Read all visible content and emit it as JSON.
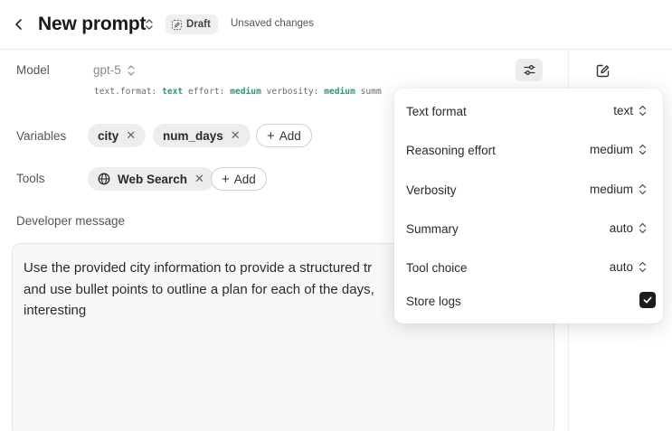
{
  "header": {
    "title": "New prompt",
    "draft_label": "Draft",
    "unsaved_label": "Unsaved changes"
  },
  "model": {
    "label": "Model",
    "value": "gpt-5",
    "params": [
      {
        "key": "text.format:",
        "value": "text"
      },
      {
        "key": "effort:",
        "value": "medium"
      },
      {
        "key": "verbosity:",
        "value": "medium"
      },
      {
        "key": "summ",
        "value": ""
      }
    ]
  },
  "variables": {
    "label": "Variables",
    "chips": [
      "city",
      "num_days"
    ],
    "add_label": "Add"
  },
  "tools": {
    "label": "Tools",
    "chips": [
      "Web Search"
    ],
    "add_label": "Add"
  },
  "developer": {
    "label": "Developer message",
    "text": "Use the provided city information to provide a structured tr\nand use bullet points to outline a plan for each of the days,\ninteresting"
  },
  "settings_popover": {
    "rows": [
      {
        "label": "Text format",
        "value": "text"
      },
      {
        "label": "Reasoning effort",
        "value": "medium"
      },
      {
        "label": "Verbosity",
        "value": "medium"
      },
      {
        "label": "Summary",
        "value": "auto"
      },
      {
        "label": "Tool choice",
        "value": "auto"
      }
    ],
    "store_logs_label": "Store logs",
    "store_logs_checked": true
  },
  "colors": {
    "param_value": "#2e9a6e",
    "checkbox": "#1c1c1c"
  },
  "icons": [
    "back-icon",
    "updown-chevron-icon",
    "draft-edit-icon",
    "settings-sliders-icon",
    "edit-icon",
    "close-icon",
    "plus-icon",
    "globe-icon",
    "check-icon"
  ]
}
